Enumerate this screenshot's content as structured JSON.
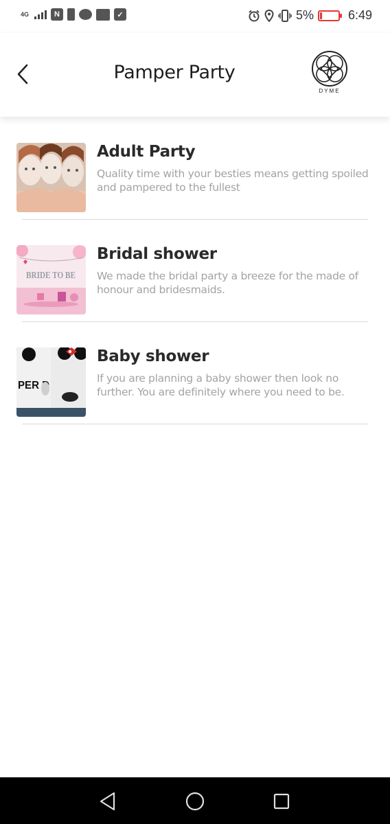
{
  "status_bar": {
    "network": "4G",
    "battery_percent": "5%",
    "time": "6:49",
    "left_icons": [
      "signal-icon",
      "nfc-icon",
      "battery-saver-icon",
      "message-icon",
      "bible-app-icon",
      "checkbox-icon"
    ],
    "right_icons": [
      "alarm-icon",
      "location-icon",
      "vibrate-icon",
      "battery-icon"
    ],
    "battery_color": "#e53935"
  },
  "header": {
    "title": "Pamper Party",
    "back_icon": "chevron-left-icon",
    "brand_name": "DYME"
  },
  "items": [
    {
      "title": "Adult Party",
      "description": "Quality time with your besties means getting spoiled and pampered to the fullest",
      "image": "face-mask-women-photo"
    },
    {
      "title": "Bridal shower",
      "description": "We made the bridal party a breeze for the made of honour and bridesmaids.",
      "image": "bride-to-be-banner-photo",
      "image_text": "BRIDE TO BE"
    },
    {
      "title": "Baby shower",
      "description": "If you are planning a baby shower then look no further. You are definitely where you need to be.",
      "image": "mickey-minnie-shirts-photo",
      "image_text": "PER D"
    }
  ],
  "nav_bar": {
    "buttons": [
      "back-triangle-icon",
      "home-circle-icon",
      "recents-square-icon"
    ]
  }
}
